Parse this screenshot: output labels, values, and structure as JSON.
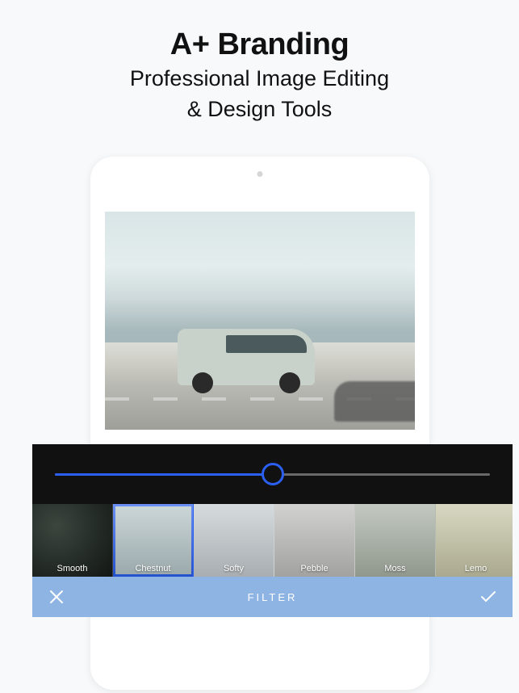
{
  "headline": {
    "title": "A+ Branding",
    "sub_line1": "Professional Image Editing",
    "sub_line2": "& Design Tools"
  },
  "slider": {
    "value_percent": 50
  },
  "filters": [
    {
      "label": "Smooth",
      "selected": false,
      "tone": "dark"
    },
    {
      "label": "Chestnut",
      "selected": true,
      "tone": "chestnut"
    },
    {
      "label": "Softy",
      "selected": false,
      "tone": "softy"
    },
    {
      "label": "Pebble",
      "selected": false,
      "tone": "pebble"
    },
    {
      "label": "Moss",
      "selected": false,
      "tone": "moss"
    },
    {
      "label": "Lemo",
      "selected": false,
      "tone": "lemon"
    }
  ],
  "bottom_bar": {
    "label": "FILTER"
  }
}
